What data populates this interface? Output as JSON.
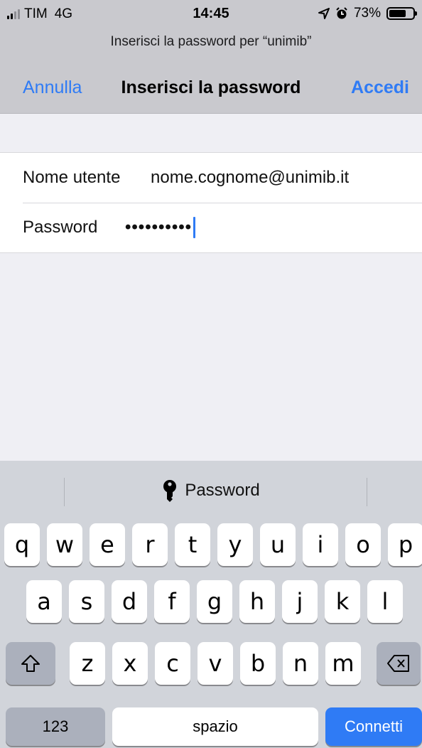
{
  "status": {
    "carrier": "TIM",
    "network": "4G",
    "time": "14:45",
    "battery": "73%",
    "battery_level": 0.73
  },
  "prompt": "Inserisci la password per “unimib”",
  "nav": {
    "cancel": "Annulla",
    "title": "Inserisci la password",
    "login": "Accedi"
  },
  "form": {
    "username_label": "Nome utente",
    "username_value": "nome.cognome@unimib.it",
    "password_label": "Password",
    "password_value": "••••••••••"
  },
  "keyboard": {
    "suggestion": "Password",
    "row1": [
      "q",
      "w",
      "e",
      "r",
      "t",
      "y",
      "u",
      "i",
      "o",
      "p"
    ],
    "row2": [
      "a",
      "s",
      "d",
      "f",
      "g",
      "h",
      "j",
      "k",
      "l"
    ],
    "row3": [
      "z",
      "x",
      "c",
      "v",
      "b",
      "n",
      "m"
    ],
    "numbers": "123",
    "space": "spazio",
    "return": "Connetti"
  },
  "colors": {
    "accent": "#2f7bf5",
    "bar": "#c9c9ce",
    "background": "#efeff4",
    "keyboard": "#d1d4da"
  }
}
